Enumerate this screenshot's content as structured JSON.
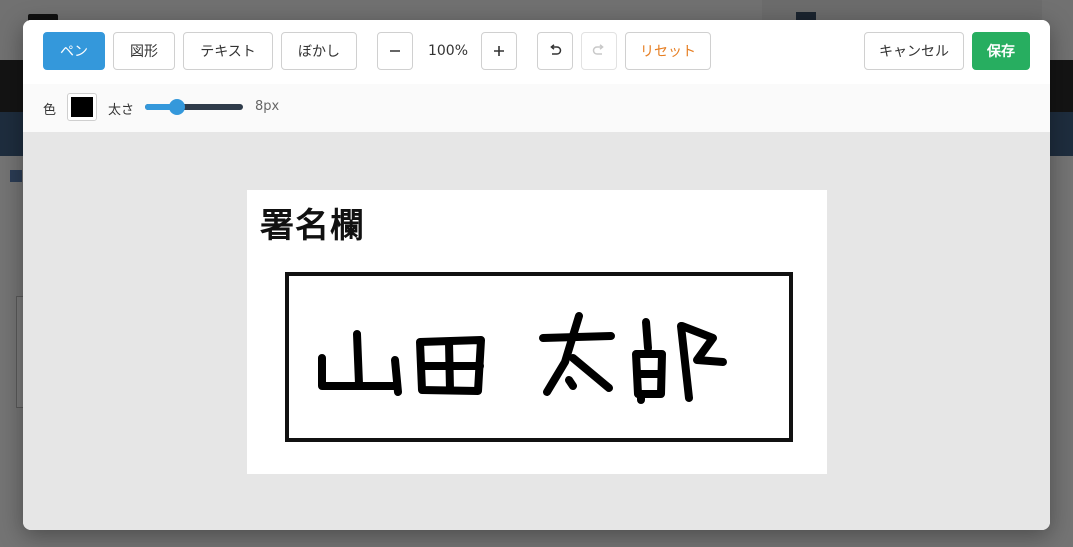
{
  "toolbar": {
    "pen_label": "ペン",
    "shape_label": "図形",
    "text_label": "テキスト",
    "blur_label": "ぼかし",
    "zoom_level": "100%",
    "zoom_out_icon": "minus-icon",
    "zoom_in_icon": "plus-icon",
    "undo_icon": "undo-icon",
    "redo_icon": "redo-icon",
    "reset_label": "リセット",
    "cancel_label": "キャンセル",
    "save_label": "保存"
  },
  "options": {
    "color_label": "色",
    "color_value": "#000000",
    "size_label": "太さ",
    "size_value": "8px",
    "size_fraction": 0.28
  },
  "document": {
    "title": "署名欄",
    "signature_text": "山田 太郎"
  },
  "colors": {
    "accent": "#3498db",
    "save": "#27ae60",
    "reset": "#e67e22"
  }
}
